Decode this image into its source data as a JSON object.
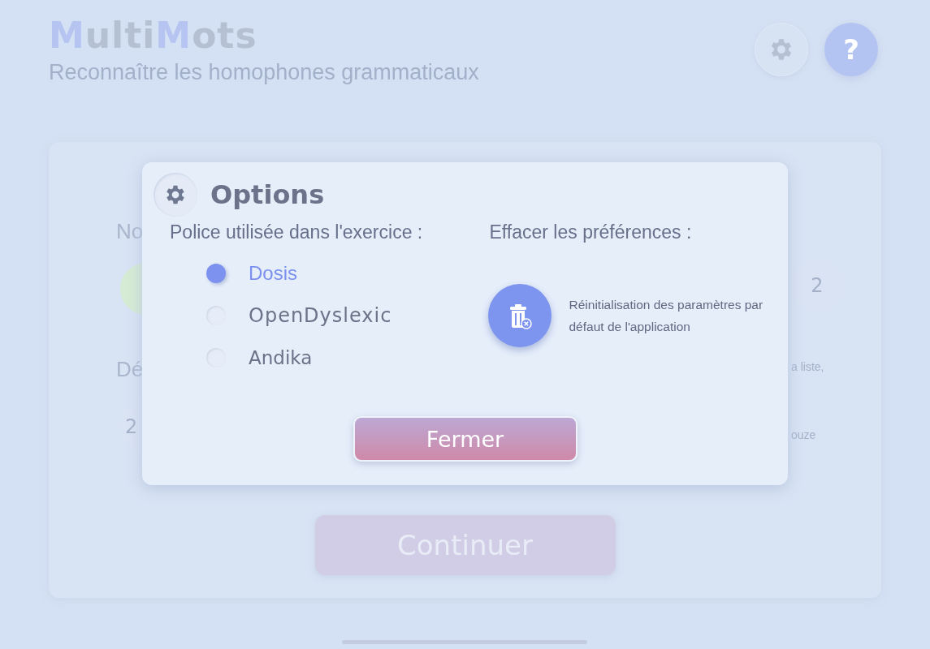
{
  "header": {
    "logo": [
      {
        "text": "M",
        "accent": true
      },
      {
        "text": "ulti",
        "accent": false
      },
      {
        "text": "M",
        "accent": true
      },
      {
        "text": "ots",
        "accent": false
      }
    ],
    "subtitle": "Reconnaître les homophones grammaticaux",
    "help_button": "?"
  },
  "background": {
    "left": [
      {
        "kind": "label",
        "text": "No"
      },
      {
        "kind": "circle",
        "color": "#d6ebd3"
      },
      {
        "kind": "label",
        "text": "Dé"
      },
      {
        "kind": "circle",
        "text": "2",
        "color": "#d9e3f3"
      }
    ],
    "right": [
      {
        "kind": "circle",
        "text": "2",
        "color": "#d9e3f3"
      },
      {
        "kind": "note",
        "text": "a liste,"
      },
      {
        "kind": "note",
        "text": "ouze"
      }
    ],
    "continue_button": "Continuer"
  },
  "dialog": {
    "title": "Options",
    "font_heading": "Police utilisée dans l'exercice :",
    "fonts": [
      {
        "label": "Dosis",
        "selected": true
      },
      {
        "label": "OpenDyslexic",
        "selected": false
      },
      {
        "label": "Andika",
        "selected": false
      }
    ],
    "reset_heading": "Effacer les préférences :",
    "reset_text": "Réinitialisation des paramètres par défaut de l'application",
    "close_button": "Fermer"
  }
}
